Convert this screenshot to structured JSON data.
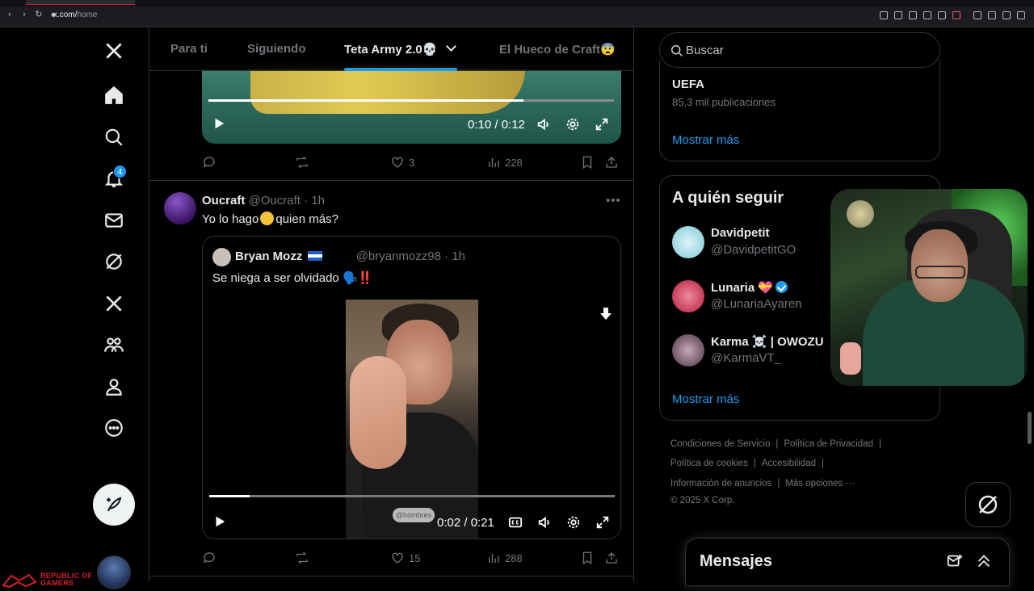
{
  "browser": {
    "url_host": "x.com/",
    "url_path": "home"
  },
  "nav": {
    "notifications_badge": "4"
  },
  "brand_overlay": {
    "line1": "REPUBLIC OF",
    "line2": "GAMERS"
  },
  "tabs": [
    {
      "label": "Para ti"
    },
    {
      "label": "Siguiendo"
    },
    {
      "label": "Teta Army 2.0💀"
    },
    {
      "label": "El Hueco de Craft😨"
    }
  ],
  "tweet1": {
    "video_time": "0:10 / 0:12",
    "likes": "3",
    "views": "228"
  },
  "tweet2": {
    "display_name": "Oucraft",
    "handle_time": "@Oucraft · 1h",
    "text_before": "Yo lo hago",
    "text_after": "quien más?",
    "likes": "15",
    "views": "288",
    "quote": {
      "display_name": "Bryan Mozz",
      "handle_time": "@bryanmozz98 · 1h",
      "text": "Se niega a ser olvidado 🗣️‼️",
      "watermark": "@hombres",
      "video_time": "0:02 / 0:21",
      "progress": 0.1
    }
  },
  "sidebar": {
    "search_placeholder": "Buscar",
    "trend": {
      "title": "UEFA",
      "subtitle": "85,3 mil publicaciones"
    },
    "show_more": "Mostrar más",
    "who_to_follow": {
      "title": "A quién seguir",
      "accounts": [
        {
          "name": "Davidpetit",
          "handle": "@DavidpetitGO"
        },
        {
          "name": "Lunaria 💝",
          "handle": "@LunariaAyaren",
          "verified": true
        },
        {
          "name": "Karma ☠️ | OWOZU",
          "handle": "@KarmaVT_"
        }
      ],
      "show_more": "Mostrar más"
    },
    "footer": {
      "links": [
        "Condiciones de Servicio",
        "Política de Privacidad",
        "Política de cookies",
        "Accesibilidad",
        "Información de anuncios",
        "Más opciones ···"
      ],
      "copyright": "© 2025 X Corp."
    }
  },
  "messages": {
    "title": "Mensajes"
  },
  "colors": {
    "accent": "#1d9bf0",
    "text": "#e7e9ea",
    "muted": "#71767b",
    "border": "#2f3336"
  }
}
